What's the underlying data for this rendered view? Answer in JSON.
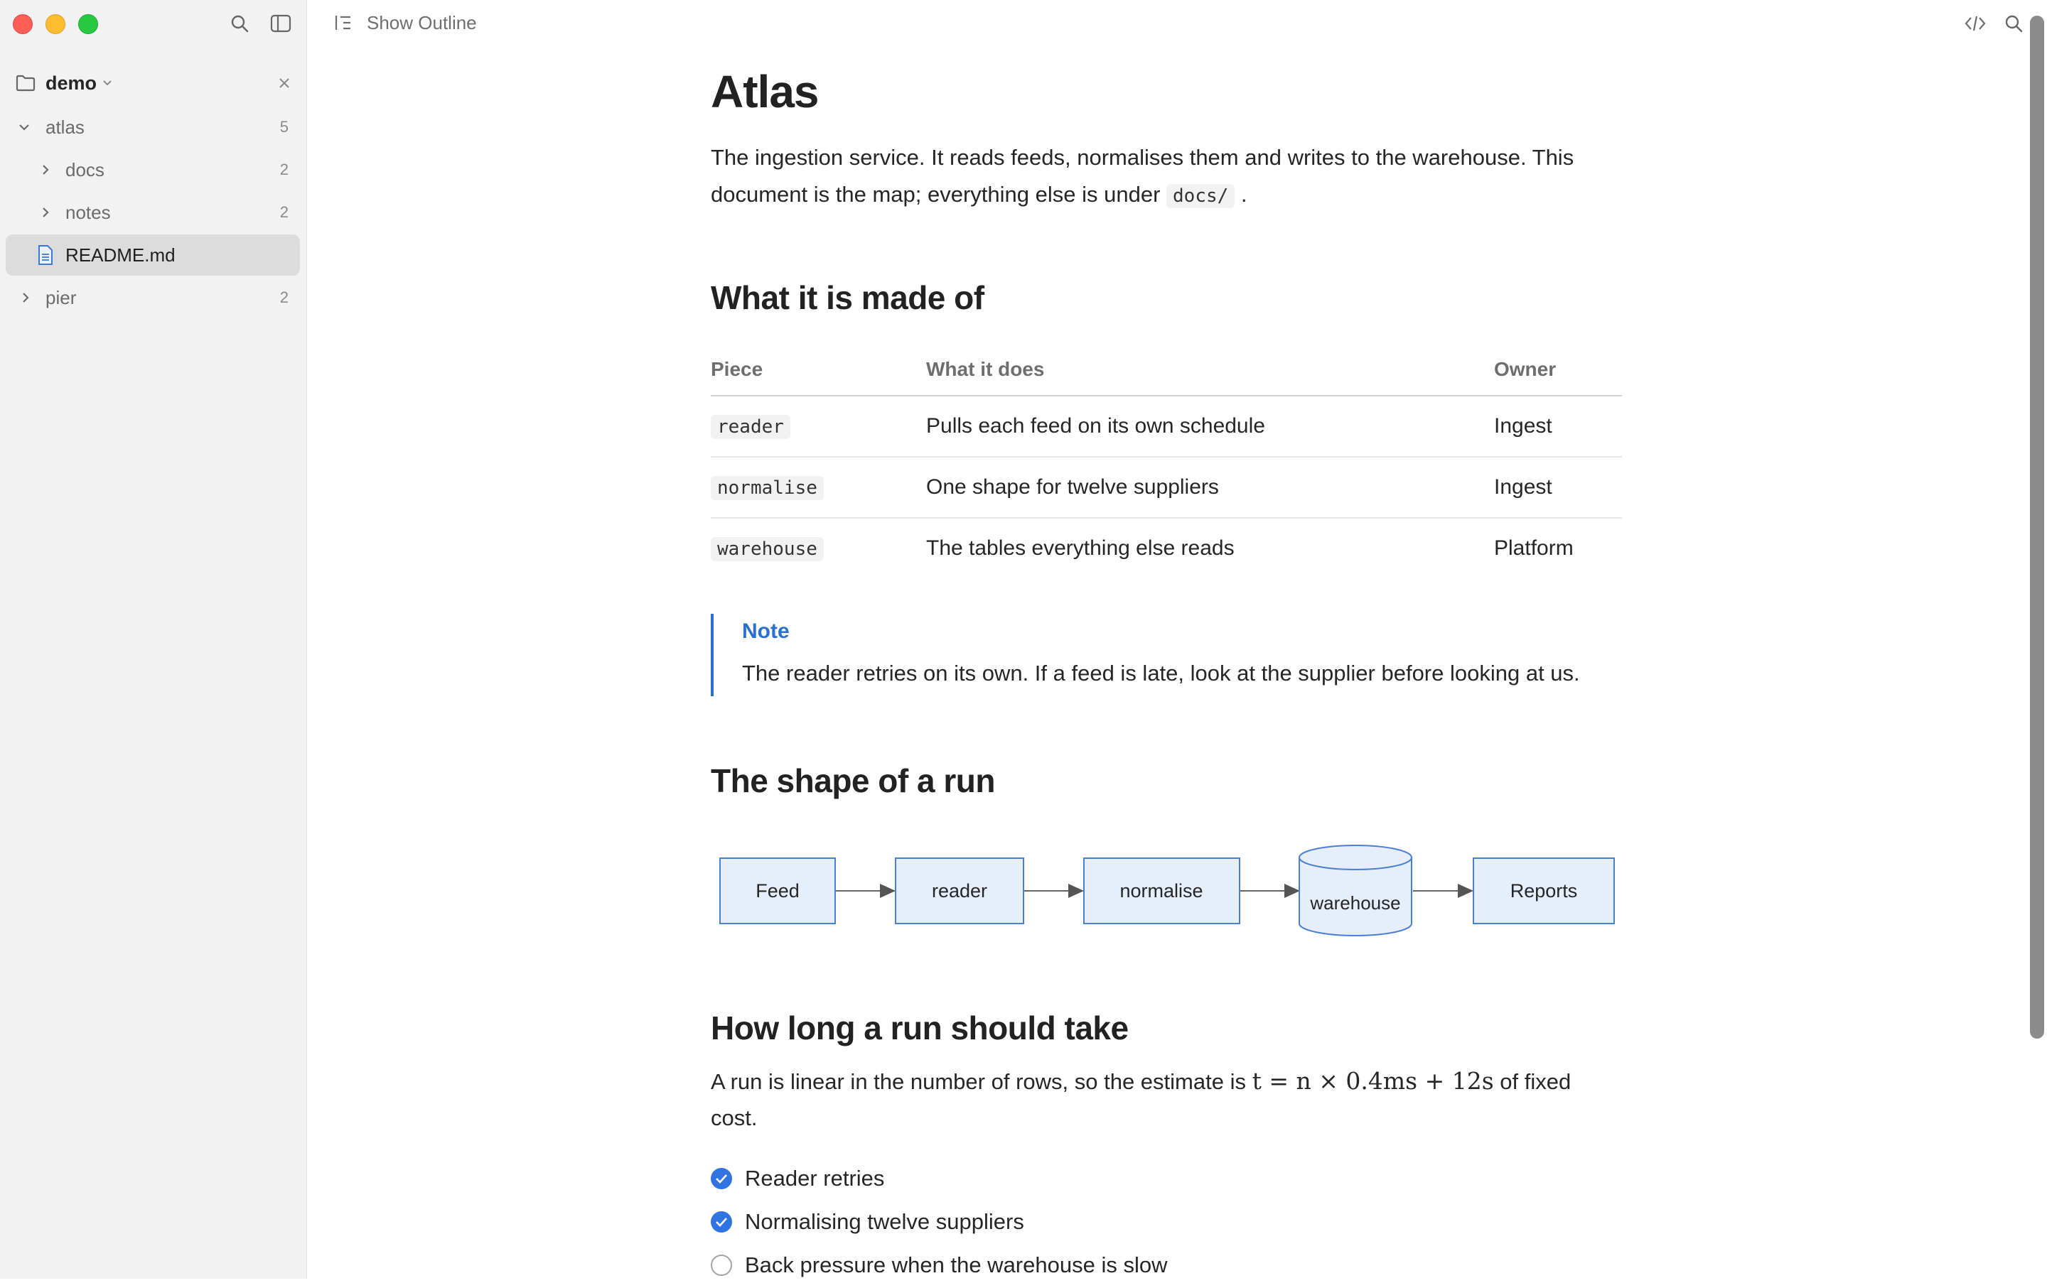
{
  "sidebar": {
    "workspace": "demo",
    "tree": [
      {
        "label": "atlas",
        "count": "5"
      },
      {
        "label": "docs",
        "count": "2"
      },
      {
        "label": "notes",
        "count": "2"
      },
      {
        "label": "README.md",
        "count": ""
      },
      {
        "label": "pier",
        "count": "2"
      }
    ]
  },
  "toolbar": {
    "outline_label": "Show Outline"
  },
  "document": {
    "title": "Atlas",
    "intro_1": "The ingestion service. It reads feeds, normalises them and writes to the warehouse. This",
    "intro_2a": "document is the map; everything else is under",
    "intro_code": "docs/",
    "intro_2b": ".",
    "h2_made_of": "What it is made of",
    "table": {
      "headers": [
        "Piece",
        "What it does",
        "Owner"
      ],
      "rows": [
        {
          "piece": "reader",
          "does": "Pulls each feed on its own schedule",
          "owner": "Ingest"
        },
        {
          "piece": "normalise",
          "does": "One shape for twelve suppliers",
          "owner": "Ingest"
        },
        {
          "piece": "warehouse",
          "does": "The tables everything else reads",
          "owner": "Platform"
        }
      ]
    },
    "note": {
      "title": "Note",
      "body": "The reader retries on its own. If a feed is late, look at the supplier before looking at us."
    },
    "h2_shape": "The shape of a run",
    "diagram": {
      "nodes": [
        "Feed",
        "reader",
        "normalise",
        "warehouse",
        "Reports"
      ]
    },
    "h2_howlong": "How long a run should take",
    "estimate_1": "A run is linear in the number of rows, so the estimate is",
    "estimate_math": "t = n × 0.4ms + 12s",
    "estimate_2": "of fixed",
    "estimate_3": "cost.",
    "tasks": [
      {
        "label": "Reader retries",
        "done": true
      },
      {
        "label": "Normalising twelve suppliers",
        "done": true
      },
      {
        "label": "Back pressure when the warehouse is slow",
        "done": false
      }
    ]
  },
  "colors": {
    "accent": "#2b6fd1",
    "sidebar_bg": "#f2f2f2",
    "selected_bg": "#dcdcdc",
    "node_fill": "#e6eefb",
    "node_stroke": "#4a7fd6"
  }
}
